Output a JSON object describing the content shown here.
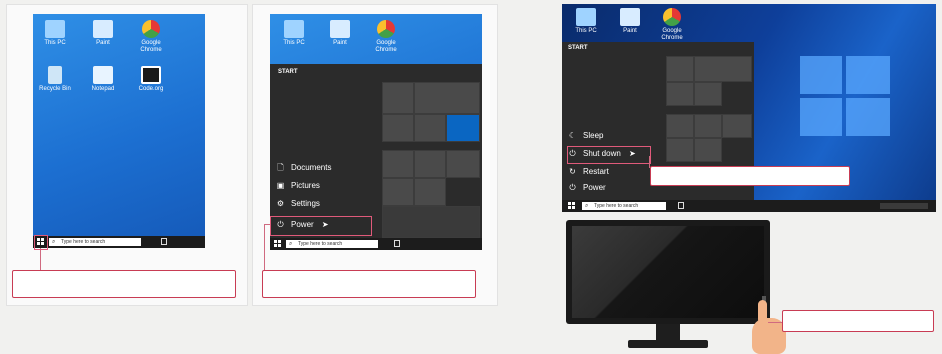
{
  "colors": {
    "accent": "#d06a80",
    "desktop": "#1f74d8",
    "taskbar": "#1c1c1c",
    "start_menu": "#2b2b2b"
  },
  "panel1": {
    "desktop_icons": [
      {
        "label": "This PC",
        "icon": "computer-icon"
      },
      {
        "label": "Paint",
        "icon": "paint-icon"
      },
      {
        "label": "Google Chrome",
        "icon": "chrome-icon"
      },
      {
        "label": "Recycle Bin",
        "icon": "recycle-bin-icon"
      },
      {
        "label": "Notepad",
        "icon": "notepad-icon"
      },
      {
        "label": "Code.org",
        "icon": "code-org-icon"
      }
    ],
    "search_placeholder": "Type here to search"
  },
  "panel2": {
    "desktop_icons": [
      {
        "label": "This PC",
        "icon": "computer-icon"
      },
      {
        "label": "Paint",
        "icon": "paint-icon"
      },
      {
        "label": "Google Chrome",
        "icon": "chrome-icon"
      }
    ],
    "start_header": "START",
    "menu_items": [
      {
        "label": "Documents",
        "icon": "document-icon"
      },
      {
        "label": "Pictures",
        "icon": "pictures-icon"
      },
      {
        "label": "Settings",
        "icon": "settings-icon"
      },
      {
        "label": "Power",
        "icon": "power-icon"
      }
    ],
    "search_placeholder": "Type here to search"
  },
  "panel3": {
    "desktop_icons": [
      {
        "label": "This PC",
        "icon": "computer-icon"
      },
      {
        "label": "Paint",
        "icon": "paint-icon"
      },
      {
        "label": "Google Chrome",
        "icon": "chrome-icon"
      }
    ],
    "start_header": "START",
    "power_options": [
      {
        "label": "Sleep",
        "icon": "sleep-icon"
      },
      {
        "label": "Shut down",
        "icon": "power-icon"
      },
      {
        "label": "Restart",
        "icon": "restart-icon"
      },
      {
        "label": "Power",
        "icon": "power-icon"
      }
    ],
    "search_placeholder": "Type here to search"
  },
  "monitor": {
    "icon": "monitor-icon",
    "hand_icon": "pointing-hand-icon"
  }
}
